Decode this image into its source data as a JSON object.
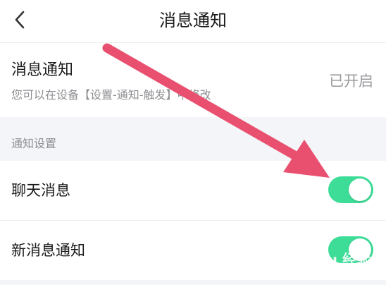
{
  "header": {
    "title": "消息通知"
  },
  "notice": {
    "title": "消息通知",
    "description": "您可以在设备【设置-通知-触发】中修改",
    "status": "已开启"
  },
  "section": {
    "title": "通知设置"
  },
  "rows": [
    {
      "label": "聊天消息",
      "enabled": true
    },
    {
      "label": "新消息通知",
      "enabled": true
    }
  ],
  "colors": {
    "toggle_on": "#3ddc97",
    "annotation_arrow": "#e9506f"
  },
  "watermark": {
    "text": "Baidu 经验",
    "sub": "jingyan.baidu.com"
  }
}
